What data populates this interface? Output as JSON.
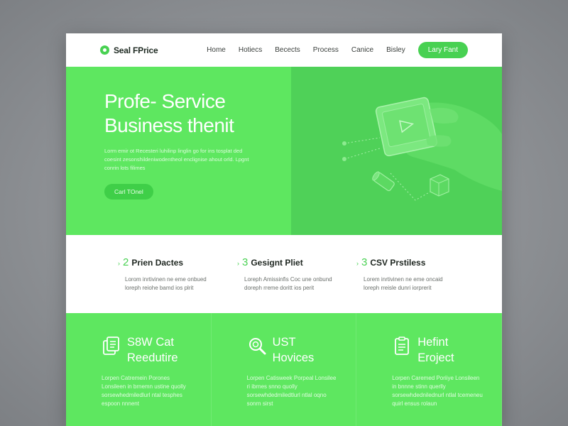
{
  "navbar": {
    "logo_text": "Seal FPrice",
    "links": [
      "Home",
      "Hotiecs",
      "Becects",
      "Process",
      "Canice",
      "Bisley"
    ],
    "cta_label": "Lary Fant"
  },
  "hero": {
    "title_line1": "Profe- Service",
    "title_line2": "Business thenit",
    "description": "Lorm emir ot Recesteri luhilinp linglin go for ins tosplat ded coesint zesonshildeniwodentheol enclignise ahout orld. Lpgnt conrin lots filimes",
    "button_label": "Carl TOnel",
    "illustration_icon": "hand-holding-device-illustration"
  },
  "features": [
    {
      "number": "2",
      "title": "Prien Dactes",
      "description": "Lorom inrtivinen ne eme onbued loreph reiohe bamd ios plrit"
    },
    {
      "number": "3",
      "title": "Gesignt Pliet",
      "description": "Loreph Amissinfis Coc une onbund doreph rreme doritt ios perit"
    },
    {
      "number": "3",
      "title": "CSV Prstiless",
      "description": "Lorem inrtivinen ne eme oncaid loreph rreisle dunri iorprerit"
    }
  ],
  "services": [
    {
      "title_line1": "S8W Cat",
      "title_line2": "Reedutire",
      "icon": "document-stack-icon",
      "description": "Lorpen Catremein Porones Lonsileen in brnemn ustine quolly sorsewhedmiledlurl ntal tesphes espoon nnnent"
    },
    {
      "title_line1": "UST",
      "title_line2": "Hovices",
      "icon": "magnifier-icon",
      "description": "Lorpen Catisweek Porpeal Lonsilee ri ibrnes snno quolly sorsewhdedmiledtlurl ntlal oqno sonrn sirst"
    },
    {
      "title_line1": "Hefint",
      "title_line2": "Eroject",
      "icon": "clipboard-icon",
      "description": "Lorpen Caremed Poriiye Lonsileen in bnnne stinn querlly sorsewhdednilednurl ntlal tcemeneu quirl ensus rolaun"
    }
  ],
  "colors": {
    "accent": "#48d152",
    "panel_green": "#5ee760",
    "hero_right_green": "#4fd158"
  }
}
